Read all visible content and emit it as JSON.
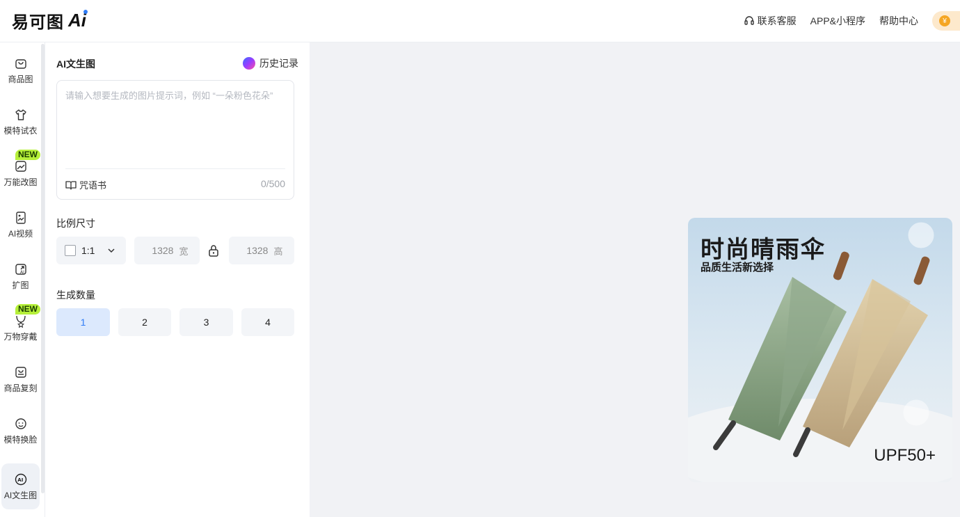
{
  "header": {
    "logo_text": "易可图",
    "logo_ai": "Ai",
    "links": {
      "contact": "联系客服",
      "app": "APP&小程序",
      "help": "帮助中心"
    }
  },
  "sidebar": {
    "items": [
      {
        "label": "商品图"
      },
      {
        "label": "模特试衣"
      },
      {
        "label": "万能改图",
        "badge": "NEW"
      },
      {
        "label": "AI视频"
      },
      {
        "label": "扩图"
      },
      {
        "label": "万物穿戴",
        "badge": "NEW"
      },
      {
        "label": "商品复刻"
      },
      {
        "label": "模特换脸"
      },
      {
        "label": "AI文生图",
        "active": true
      }
    ]
  },
  "panel": {
    "title": "AI文生图",
    "history": "历史记录",
    "prompt": {
      "placeholder": "请输入想要生成的图片提示词，例如 “一朵粉色花朵”",
      "value": "",
      "spellbook": "咒语书",
      "counter": "0/500"
    },
    "ratio": {
      "label": "比例尺寸",
      "selected": "1:1",
      "width": "1328",
      "width_unit": "宽",
      "height": "1328",
      "height_unit": "高"
    },
    "quantity": {
      "label": "生成数量",
      "options": [
        "1",
        "2",
        "3",
        "4"
      ],
      "selected": "1"
    }
  },
  "preview": {
    "title": "时尚晴雨伞",
    "subtitle": "品质生活新选择",
    "tag": "UPF50+"
  },
  "colors": {
    "accent": "#2f7cf6",
    "badge": "#b6f03a",
    "canvas_bg": "#f1f2f5"
  }
}
